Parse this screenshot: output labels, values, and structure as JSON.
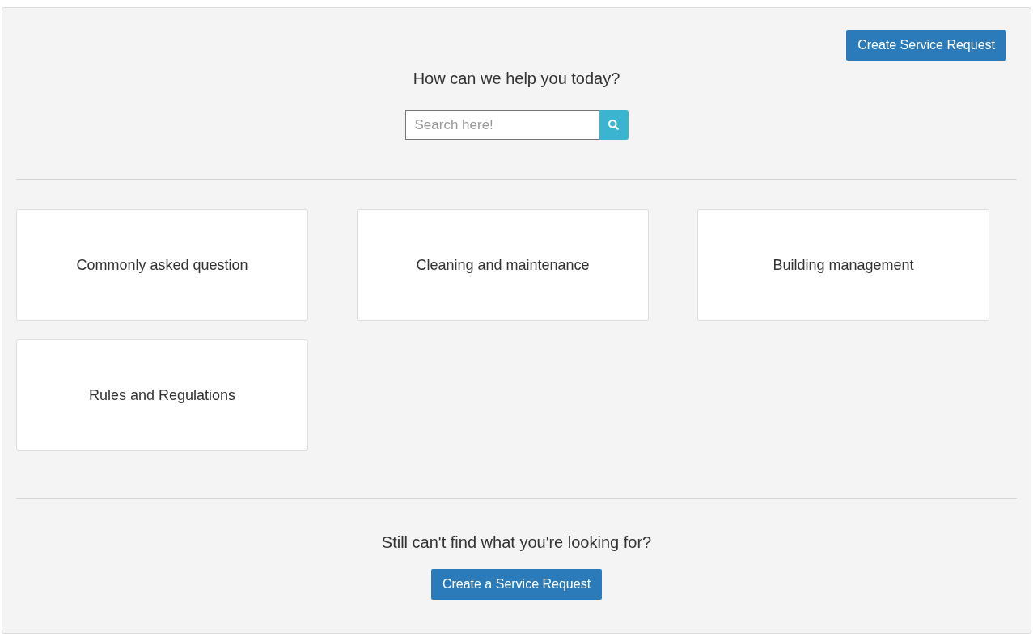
{
  "header": {
    "create_button": "Create Service Request"
  },
  "search": {
    "heading": "How can we help you today?",
    "placeholder": "Search here!"
  },
  "categories": [
    {
      "title": "Commonly asked question"
    },
    {
      "title": "Cleaning and maintenance"
    },
    {
      "title": "Building management"
    },
    {
      "title": "Rules and Regulations"
    }
  ],
  "footer": {
    "heading": "Still can't find what you're looking for?",
    "button": "Create a Service Request"
  }
}
